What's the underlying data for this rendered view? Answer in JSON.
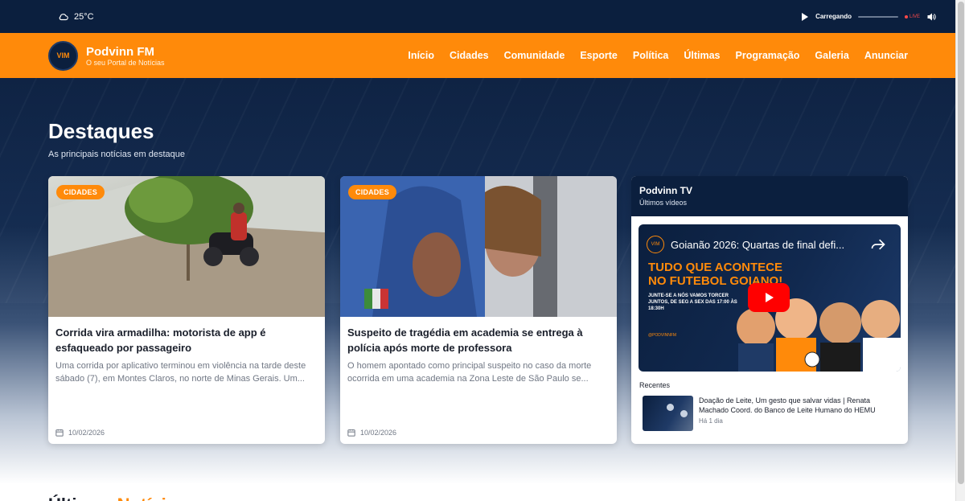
{
  "topbar": {
    "temperature": "25°C",
    "player_status": "Carregando",
    "live_label": "LIVE"
  },
  "brand": {
    "name": "Podvinn FM",
    "slogan": "O seu Portal de Notícias",
    "logo_text": "VIM"
  },
  "nav": {
    "items": [
      "Início",
      "Cidades",
      "Comunidade",
      "Esporte",
      "Política",
      "Últimas",
      "Programação",
      "Galeria",
      "Anunciar"
    ]
  },
  "highlights": {
    "title": "Destaques",
    "subtitle": "As principais notícias em destaque"
  },
  "cards": [
    {
      "badge": "CIDADES",
      "title": "Corrida vira armadilha: motorista de app é esfaqueado por passageiro",
      "excerpt": "Uma corrida por aplicativo terminou em violência na tarde deste sábado (7), em Montes Claros, no norte de Minas Gerais. Um...",
      "date": "10/02/2026"
    },
    {
      "badge": "CIDADES",
      "title": "Suspeito de tragédia em academia se entrega à polícia após morte de professora",
      "excerpt": "O homem apontado como principal suspeito no caso da morte ocorrida em uma academia na Zona Leste de São Paulo se...",
      "date": "10/02/2026"
    }
  ],
  "tv": {
    "title": "Podvinn TV",
    "subtitle": "Últimos vídeos",
    "video_title": "Goianão 2026: Quartas de final defi...",
    "video_headline_1": "TUDO QUE ACONTECE",
    "video_headline_2": "NO FUTEBOL GOIANO!",
    "video_small": "JUNTE-SE A NÓS VAMOS TORCER JUNTOS, DE SEG A SEX DAS 17:00 ÀS 18:30H",
    "video_handle": "@PODVINNFM",
    "recent_label": "Recentes",
    "recent": [
      {
        "title": "Doação de Leite, Um gesto que salvar vidas | Renata Machado Coord. do Banco de Leite Humano do HEMU",
        "time": "Há 1 dia"
      }
    ]
  },
  "latest": {
    "title_part1": "Últimas",
    "title_part2": "Notícias"
  },
  "colors": {
    "accent": "#ff8a0a",
    "navy": "#0b1f3e",
    "youtube": "#ff0000"
  }
}
